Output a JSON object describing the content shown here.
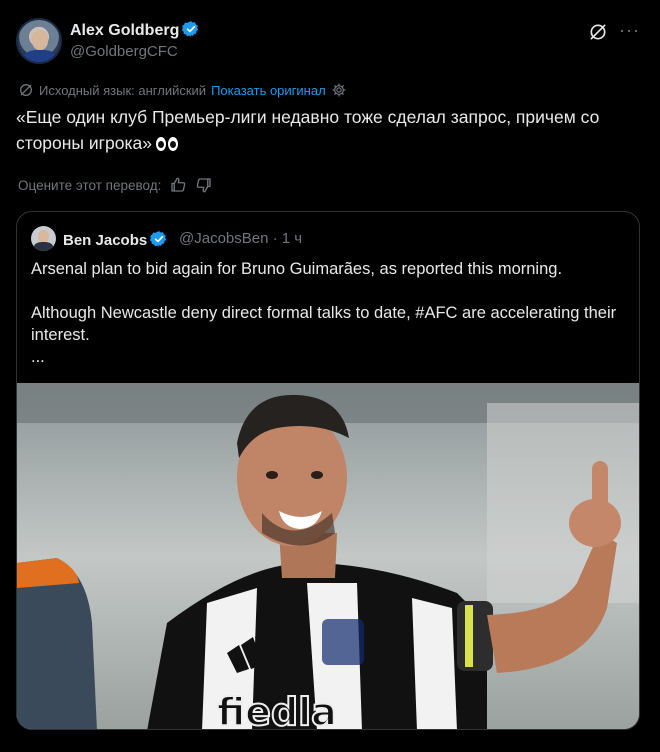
{
  "tweet": {
    "author_name": "Alex Goldberg",
    "author_handle": "@GoldbergCFC",
    "translation": {
      "source_language": "Исходный язык: английский",
      "show_original": "Показать оригинал"
    },
    "text": "«Еще один клуб Премьер-лиги недавно тоже сделал запрос, причем со стороны игрока»",
    "rate_translation": "Оцените этот перевод:"
  },
  "quoted": {
    "author_name": "Ben Jacobs",
    "author_handle": "@JacobsBen · 1 ч",
    "text": "Arsenal plan to bid again for Bruno Guimarães, as reported this morning.\n\nAlthough Newcastle deny direct formal talks to date, #AFC are accelerating their interest.\n...",
    "image_text": "fiedla"
  },
  "icons": {
    "verified": "verified-badge-icon",
    "grok": "grok-icon",
    "more": "more-icon",
    "translate": "translate-icon",
    "settings": "gear-icon",
    "thumbs_up": "thumbs-up-icon",
    "thumbs_down": "thumbs-down-icon",
    "eyes_emoji": "eyes-emoji-icon"
  },
  "colors": {
    "background": "#000000",
    "text": "#e7e9ea",
    "muted": "#71767b",
    "link": "#1d9bf0",
    "border": "#2f3336",
    "verified": "#1d9bf0"
  }
}
